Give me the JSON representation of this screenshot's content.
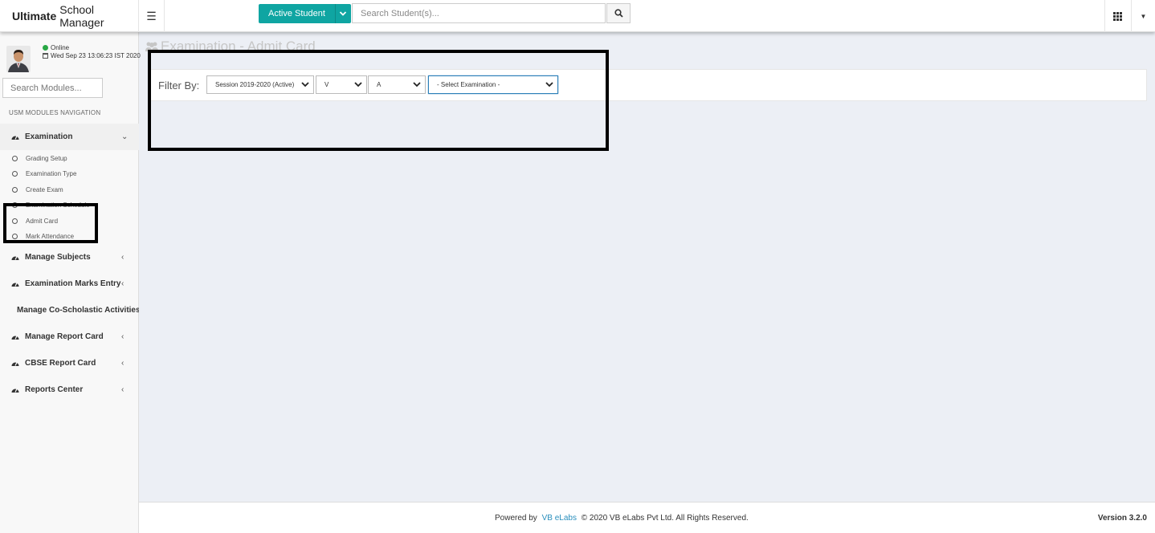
{
  "header": {
    "brand_bold": "Ultimate",
    "brand_rest": "School Manager",
    "active_student_label": "Active Student",
    "search_placeholder": "Search Student(s)..."
  },
  "sidebar": {
    "status": "Online",
    "datetime": "Wed Sep 23 13:06:23 IST 2020",
    "search_placeholder": "Search Modules...",
    "nav_heading": "USM MODULES NAVIGATION",
    "groups": [
      {
        "label": "Examination",
        "expanded": true
      },
      {
        "label": "Manage Subjects"
      },
      {
        "label": "Examination Marks Entry"
      },
      {
        "label": "Manage Co-Scholastic Activities"
      },
      {
        "label": "Manage Report Card"
      },
      {
        "label": "CBSE Report Card"
      },
      {
        "label": "Reports Center"
      }
    ],
    "examination_items": [
      {
        "label": "Grading Setup"
      },
      {
        "label": "Examination Type"
      },
      {
        "label": "Create Exam"
      },
      {
        "label": "Examination Schedule"
      },
      {
        "label": "Admit Card"
      },
      {
        "label": "Mark Attendance"
      }
    ]
  },
  "main": {
    "page_title": "Examination - Admit Card",
    "filter_label": "Filter By:",
    "session_select": "Session 2019-2020 (Active)",
    "class_select": "V",
    "section_select": "A",
    "exam_select": "- Select Examination -"
  },
  "footer": {
    "powered_by": "Powered by",
    "company_link": "VB eLabs",
    "copyright": "© 2020 VB eLabs Pvt Ltd. All Rights Reserved.",
    "version": "Version 3.2.0"
  },
  "colors": {
    "accent": "#0fa5a2",
    "link": "#2a8fbd",
    "background": "#eceff5",
    "online": "#28a745"
  }
}
